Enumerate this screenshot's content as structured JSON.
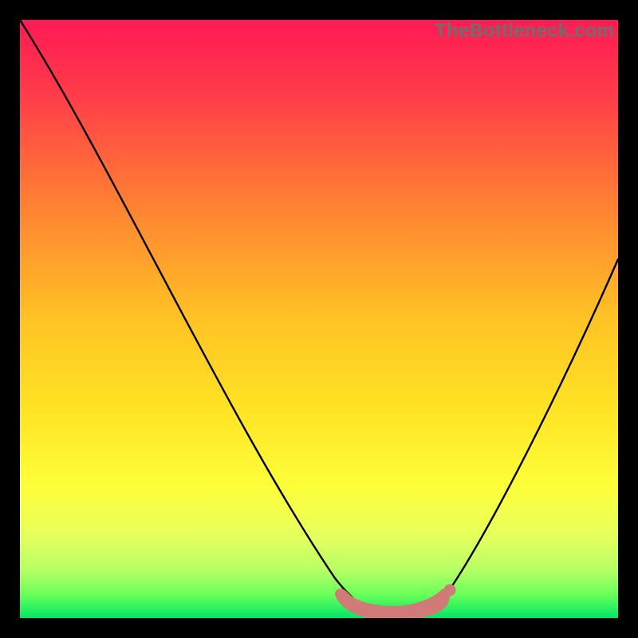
{
  "watermark": "TheBottleneck.com",
  "chart_data": {
    "type": "line",
    "title": "",
    "xlabel": "",
    "ylabel": "",
    "xlim": [
      0,
      100
    ],
    "ylim": [
      0,
      100
    ],
    "grid": false,
    "legend": false,
    "series": [
      {
        "name": "Bottleneck curve",
        "x": [
          0,
          5,
          10,
          15,
          20,
          25,
          30,
          35,
          40,
          45,
          50,
          55,
          58,
          60,
          62,
          65,
          68,
          70,
          75,
          80,
          85,
          90,
          95,
          100
        ],
        "y": [
          100,
          92,
          84,
          76,
          68,
          59,
          51,
          42,
          34,
          25,
          16,
          8,
          3,
          1,
          0,
          0,
          0,
          1,
          7,
          16,
          26,
          37,
          48,
          60
        ]
      },
      {
        "name": "Optimal zone marker",
        "x": [
          55,
          58,
          60,
          62,
          64,
          66,
          68,
          69,
          70
        ],
        "y": [
          3,
          0.8,
          0.5,
          0.4,
          0.4,
          0.5,
          0.8,
          1.5,
          4
        ]
      }
    ],
    "background_gradient": {
      "top": "#ff1a54",
      "mid_upper": "#ff8f2a",
      "mid": "#ffe324",
      "mid_lower": "#f8ff58",
      "near_bottom": "#8dff52",
      "bottom": "#00e865"
    },
    "highlight_color": "#d07b77"
  }
}
